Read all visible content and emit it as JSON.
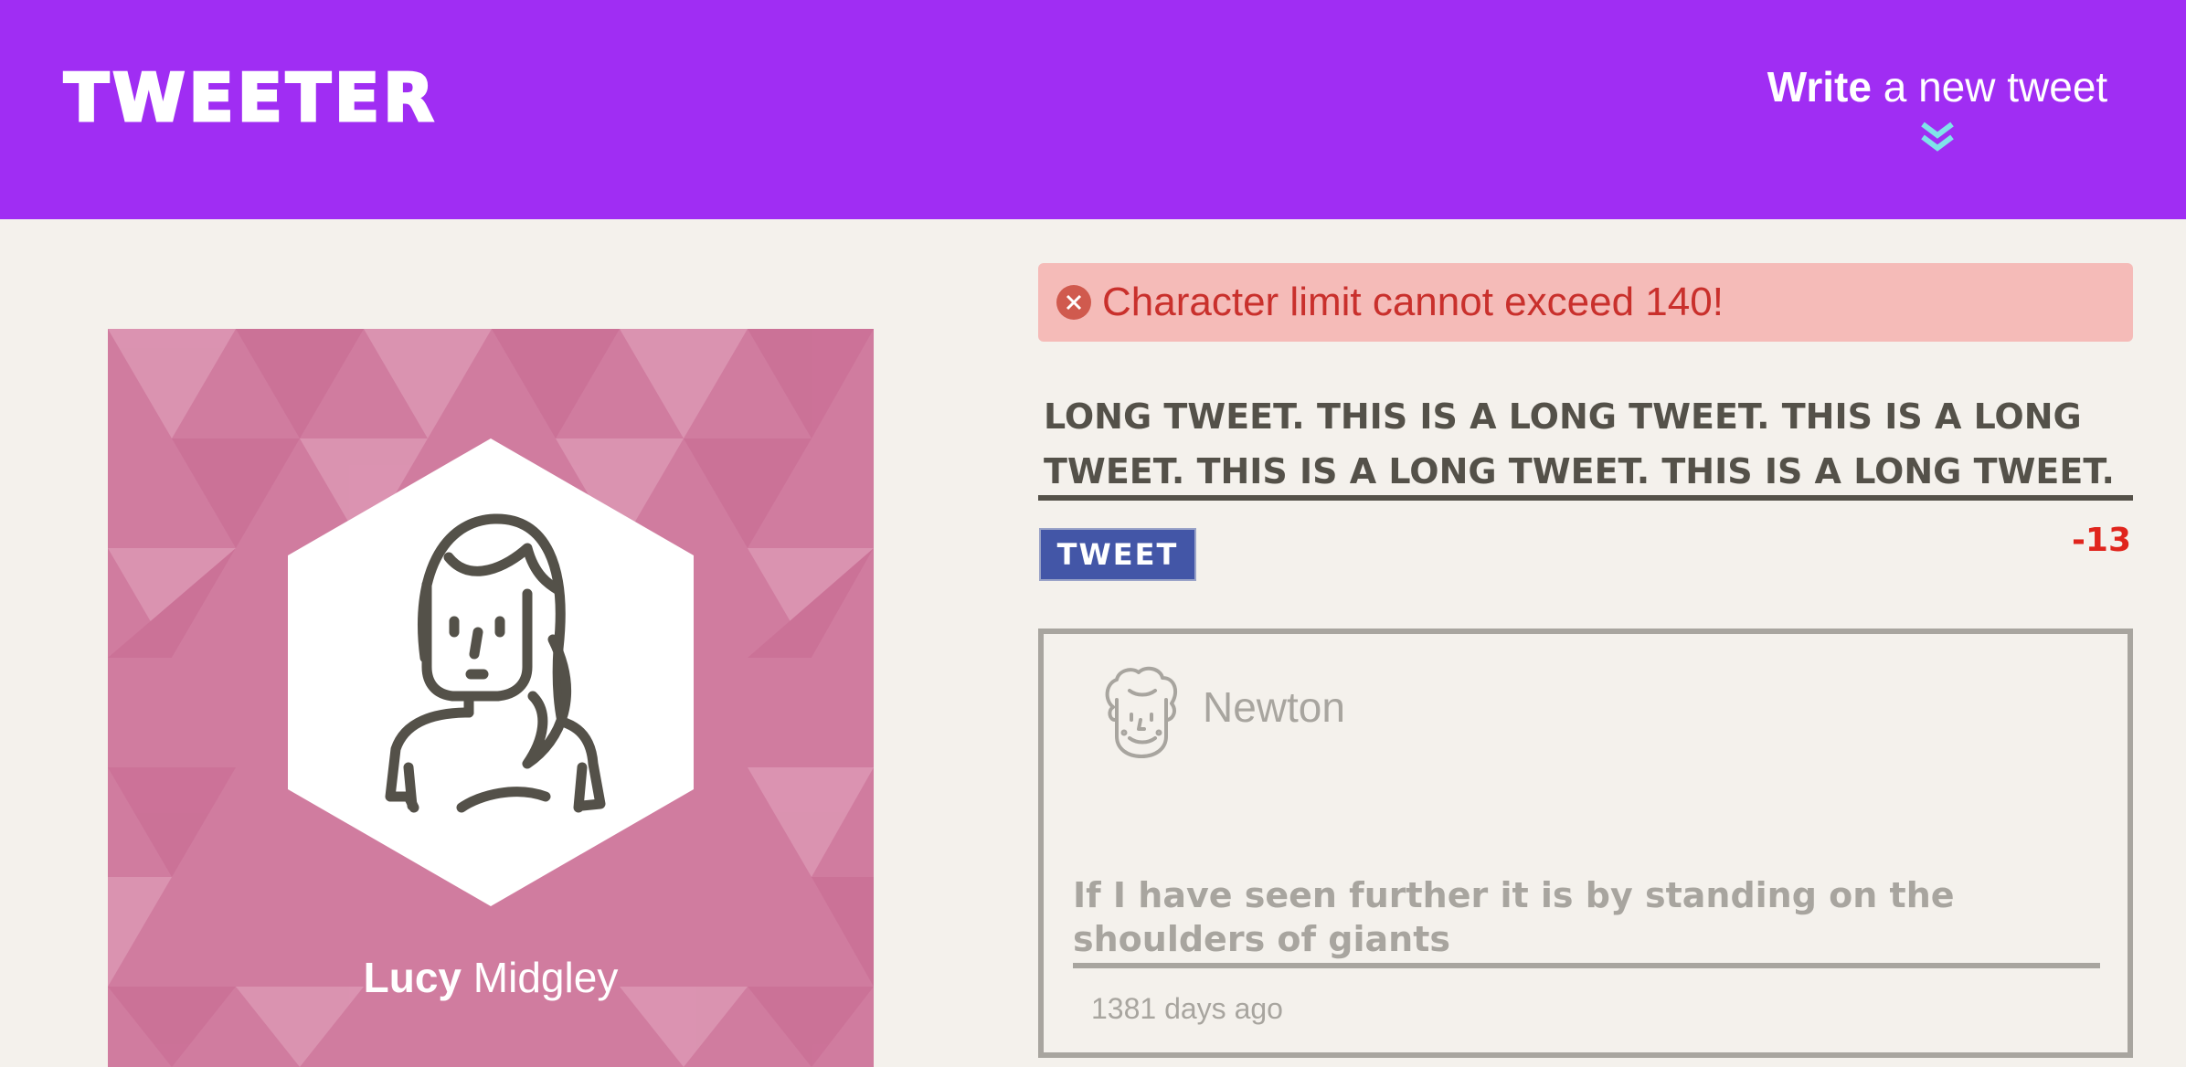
{
  "header": {
    "brand": "TWEETER",
    "compose_bold": "Write",
    "compose_rest": " a new tweet",
    "chevron_icon": "chevron-double-down-icon",
    "background_color": "#a02df3",
    "chevron_color": "#7fe3e9"
  },
  "profile": {
    "first_name": "Lucy",
    "last_name": " Midgley",
    "avatar_icon": "woman-avatar-icon",
    "background_color": "#d07c9f"
  },
  "error": {
    "message": "Character limit cannot exceed 140!",
    "icon": "close-circle-icon"
  },
  "composer": {
    "value": "LONG TWEET. THIS IS A LONG TWEET. THIS IS A LONG TWEET. THIS IS A LONG TWEET. THIS IS A LONG TWEET.",
    "button_label": "TWEET",
    "counter": "-13"
  },
  "tweets": [
    {
      "author": "Newton",
      "avatar_icon": "man-avatar-icon",
      "text": "If I have seen further it is by standing on the shoulders of giants",
      "time": "1381 days ago"
    }
  ]
}
